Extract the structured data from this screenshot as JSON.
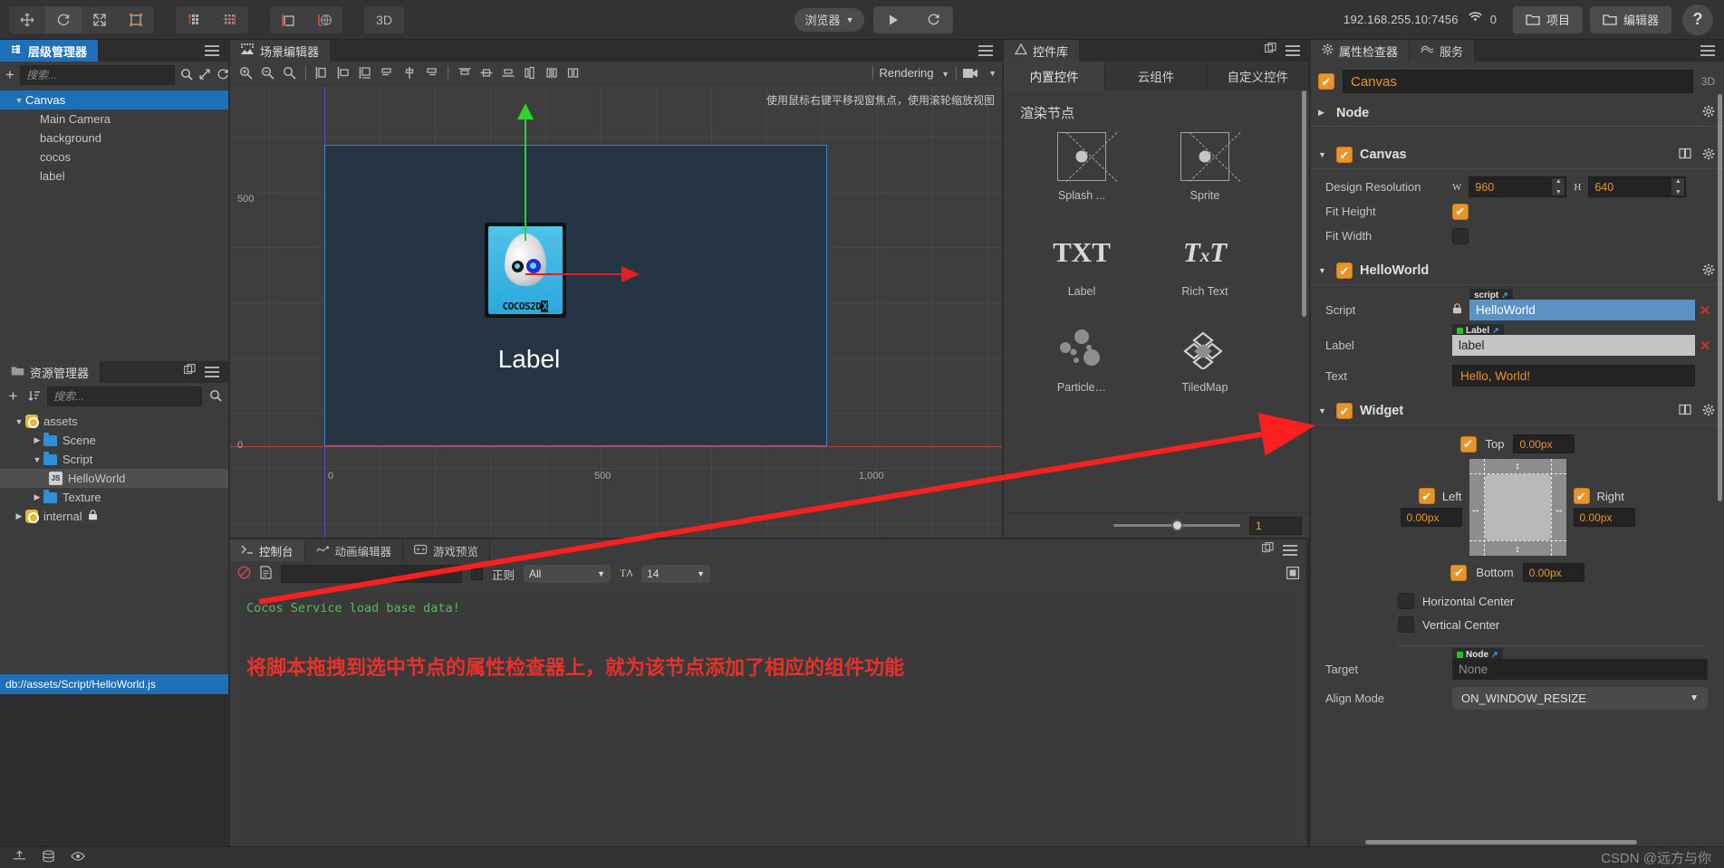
{
  "topbar": {
    "transform_tools": [
      {
        "name": "move-tool",
        "icon": "move-icon",
        "active": false
      },
      {
        "name": "rotate-tool",
        "icon": "rotate-icon",
        "active": true
      },
      {
        "name": "scale-tool",
        "icon": "scale-icon",
        "active": false
      },
      {
        "name": "rect-tool",
        "icon": "rect-transform-icon",
        "active": false
      }
    ],
    "pivot_tools": [
      {
        "name": "pivot-tool",
        "icon": "pivot-icon"
      },
      {
        "name": "coord-tool",
        "icon": "coordinate-icon"
      }
    ],
    "anchor_tools": [
      {
        "name": "anchor-tool",
        "icon": "anchor-icon"
      },
      {
        "name": "global-tool",
        "icon": "global-icon"
      }
    ],
    "mode_3d": "3D",
    "preview_target": "浏览器",
    "play_label": "▶",
    "refresh_label": "⟳",
    "ip_address": "192.168.255.10:7456",
    "connection_count": "0",
    "project_button": "项目",
    "editor_button": "编辑器",
    "help_button": "?"
  },
  "hierarchy": {
    "tab_title": "层级管理器",
    "search_placeholder": "搜索...",
    "add_label": "+",
    "nodes": [
      {
        "label": "Canvas",
        "depth": 0,
        "expanded": true,
        "selected": true
      },
      {
        "label": "Main Camera",
        "depth": 1,
        "selected": false
      },
      {
        "label": "background",
        "depth": 1,
        "selected": false
      },
      {
        "label": "cocos",
        "depth": 1,
        "selected": false
      },
      {
        "label": "label",
        "depth": 1,
        "selected": false
      }
    ]
  },
  "assets": {
    "tab_title": "资源管理器",
    "search_placeholder": "搜索...",
    "status_path": "db://assets/Script/HelloWorld.js",
    "nodes": [
      {
        "label": "assets",
        "type": "db",
        "depth": 0,
        "expanded": true,
        "selected": false
      },
      {
        "label": "Scene",
        "type": "folder",
        "depth": 1,
        "expanded": false,
        "selected": false
      },
      {
        "label": "Script",
        "type": "folder",
        "depth": 1,
        "expanded": true,
        "selected": false
      },
      {
        "label": "HelloWorld",
        "type": "js",
        "depth": 2,
        "selected": true
      },
      {
        "label": "Texture",
        "type": "folder",
        "depth": 1,
        "expanded": false,
        "selected": false
      },
      {
        "label": "internal",
        "type": "db",
        "depth": 0,
        "expanded": false,
        "locked": true,
        "selected": false
      }
    ]
  },
  "scene": {
    "tab_title": "场景编辑器",
    "rendering_label": "Rendering",
    "hint": "使用鼠标右键平移视窗焦点，使用滚轮缩放视图",
    "ruler_y_500": "500",
    "ruler_y_0": "0",
    "ruler_x_0": "0",
    "ruler_x_500": "500",
    "ruler_x_1000": "1,000",
    "canvas_label_text": "Label",
    "sprite_word": "COCOS2D",
    "sprite_word_suffix": "X"
  },
  "widget_library": {
    "tab_title": "控件库",
    "tabs": [
      {
        "label": "内置控件",
        "active": true
      },
      {
        "label": "云组件",
        "active": false
      },
      {
        "label": "自定义控件",
        "active": false
      }
    ],
    "section_title": "渲染节点",
    "items": [
      {
        "label": "Splash ...",
        "icon": "placeholder-icon"
      },
      {
        "label": "Sprite",
        "icon": "placeholder-icon"
      },
      {
        "label": "Label",
        "icon": "txt-icon"
      },
      {
        "label": "Rich Text",
        "icon": "rich-text-icon"
      },
      {
        "label": "Particle…",
        "icon": "particle-icon"
      },
      {
        "label": "TiledMap",
        "icon": "tiledmap-icon"
      }
    ],
    "zoom_value": "1"
  },
  "inspector": {
    "tabs": [
      {
        "label": "属性检查器",
        "active": true,
        "icon": "gear-icon"
      },
      {
        "label": "服务",
        "active": false,
        "icon": "service-icon"
      }
    ],
    "node_name": "Canvas",
    "node_enabled": true,
    "mode_3d": "3D",
    "sections": {
      "node": {
        "title": "Node",
        "expanded": false
      },
      "canvas": {
        "title": "Canvas",
        "enabled": true,
        "expanded": true,
        "design_resolution_label": "Design Resolution",
        "width_label": "W",
        "width_value": "960",
        "height_label": "H",
        "height_value": "640",
        "fit_height_label": "Fit Height",
        "fit_height_checked": true,
        "fit_width_label": "Fit Width",
        "fit_width_checked": false
      },
      "helloworld": {
        "title": "HelloWorld",
        "enabled": true,
        "expanded": true,
        "script_label": "Script",
        "script_tag": "script",
        "script_value": "HelloWorld",
        "label_label": "Label",
        "label_tag": "Label",
        "label_value": "label",
        "text_label": "Text",
        "text_value": "Hello, World!"
      },
      "widget": {
        "title": "Widget",
        "enabled": true,
        "expanded": true,
        "top_label": "Top",
        "top_checked": true,
        "top_value": "0.00px",
        "left_label": "Left",
        "left_checked": true,
        "left_value": "0.00px",
        "right_label": "Right",
        "right_checked": true,
        "right_value": "0.00px",
        "bottom_label": "Bottom",
        "bottom_checked": true,
        "bottom_value": "0.00px",
        "horizontal_center_label": "Horizontal Center",
        "horizontal_center_checked": false,
        "vertical_center_label": "Vertical Center",
        "vertical_center_checked": false,
        "target_label": "Target",
        "target_tag": "Node",
        "target_value": "None",
        "align_mode_label": "Align Mode",
        "align_mode_value": "ON_WINDOW_RESIZE"
      }
    }
  },
  "console": {
    "tabs": [
      {
        "label": "控制台",
        "active": true,
        "icon": "console-icon"
      },
      {
        "label": "动画编辑器",
        "active": false,
        "icon": "animation-icon"
      },
      {
        "label": "游戏预览",
        "active": false,
        "icon": "game-preview-icon"
      }
    ],
    "regex_label": "正则",
    "filter_value": "All",
    "fontsize_value": "14",
    "log_lines": [
      "Cocos Service load base data!"
    ],
    "annotation": "将脚本拖拽到选中节点的属性检查器上，就为该节点添加了相应的组件功能"
  },
  "bottombar": {
    "watermark": "CSDN @远方与你"
  },
  "colors": {
    "accent_orange": "#e8932c",
    "select_blue": "#1d6fb8",
    "panel_bg": "#3c3c3c",
    "annotation_red": "#e8312a"
  }
}
